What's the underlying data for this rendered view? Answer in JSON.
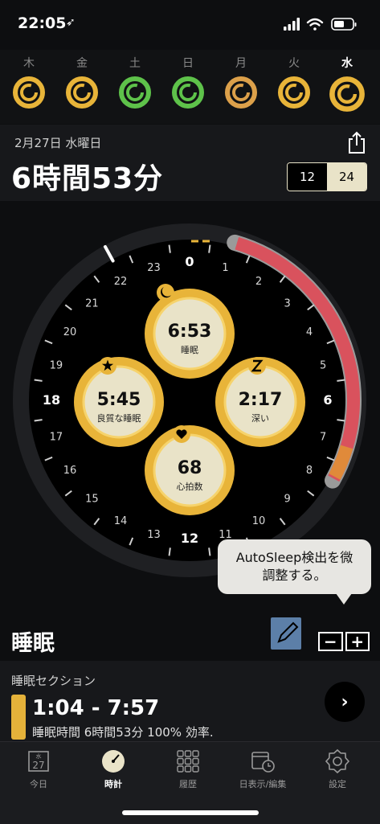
{
  "status_bar": {
    "time": "22:05",
    "location_glyph": "➶"
  },
  "week": [
    {
      "label": "木",
      "ring_color": "#e8b439",
      "active": false
    },
    {
      "label": "金",
      "ring_color": "#e8b439",
      "active": false
    },
    {
      "label": "土",
      "ring_color": "#5ec24a",
      "active": false
    },
    {
      "label": "日",
      "ring_color": "#5ec24a",
      "active": false
    },
    {
      "label": "月",
      "ring_color": "#dca04a",
      "active": false
    },
    {
      "label": "火",
      "ring_color": "#e8b439",
      "active": false
    },
    {
      "label": "水",
      "ring_color": "#e8b439",
      "active": true
    }
  ],
  "header": {
    "date": "2月27日 水曜日",
    "total_sleep": "6時間53分",
    "seg_12": "12",
    "seg_24": "24"
  },
  "clock": {
    "hours": [
      "0",
      "1",
      "2",
      "3",
      "4",
      "5",
      "6",
      "7",
      "8",
      "9",
      "10",
      "11",
      "12",
      "13",
      "14",
      "15",
      "16",
      "17",
      "18",
      "19",
      "20",
      "21",
      "22",
      "23"
    ],
    "sleep_arc_color": "#d9525d",
    "accent": "#e8b439",
    "stats": [
      {
        "value": "6:53",
        "label": "睡眠",
        "icon": "moon-icon"
      },
      {
        "value": "5:45",
        "label": "良質な睡眠",
        "icon": "star-icon"
      },
      {
        "value": "2:17",
        "label": "深い",
        "icon": "z-icon"
      },
      {
        "value": "68",
        "label": "心拍数",
        "icon": "heart-icon"
      }
    ]
  },
  "tooltip": {
    "line1": "AutoSleep検出を微",
    "line2": "調整する。"
  },
  "sleep": {
    "title": "睡眠",
    "minus": "−",
    "plus": "+"
  },
  "section": {
    "title": "睡眠セクション",
    "range": "1:04 - 7:57",
    "detail": "睡眠時間 6時間53分 100% 効率.",
    "go": "›"
  },
  "tabs": [
    {
      "label": "今日",
      "icon": "calendar-icon",
      "day": "27",
      "dow": "水",
      "active": false
    },
    {
      "label": "時計",
      "icon": "clock-icon",
      "active": true
    },
    {
      "label": "履歴",
      "icon": "grid-icon",
      "active": false
    },
    {
      "label": "日表示/編集",
      "icon": "calendar-clock-icon",
      "active": false
    },
    {
      "label": "設定",
      "icon": "gear-icon",
      "active": false
    }
  ]
}
